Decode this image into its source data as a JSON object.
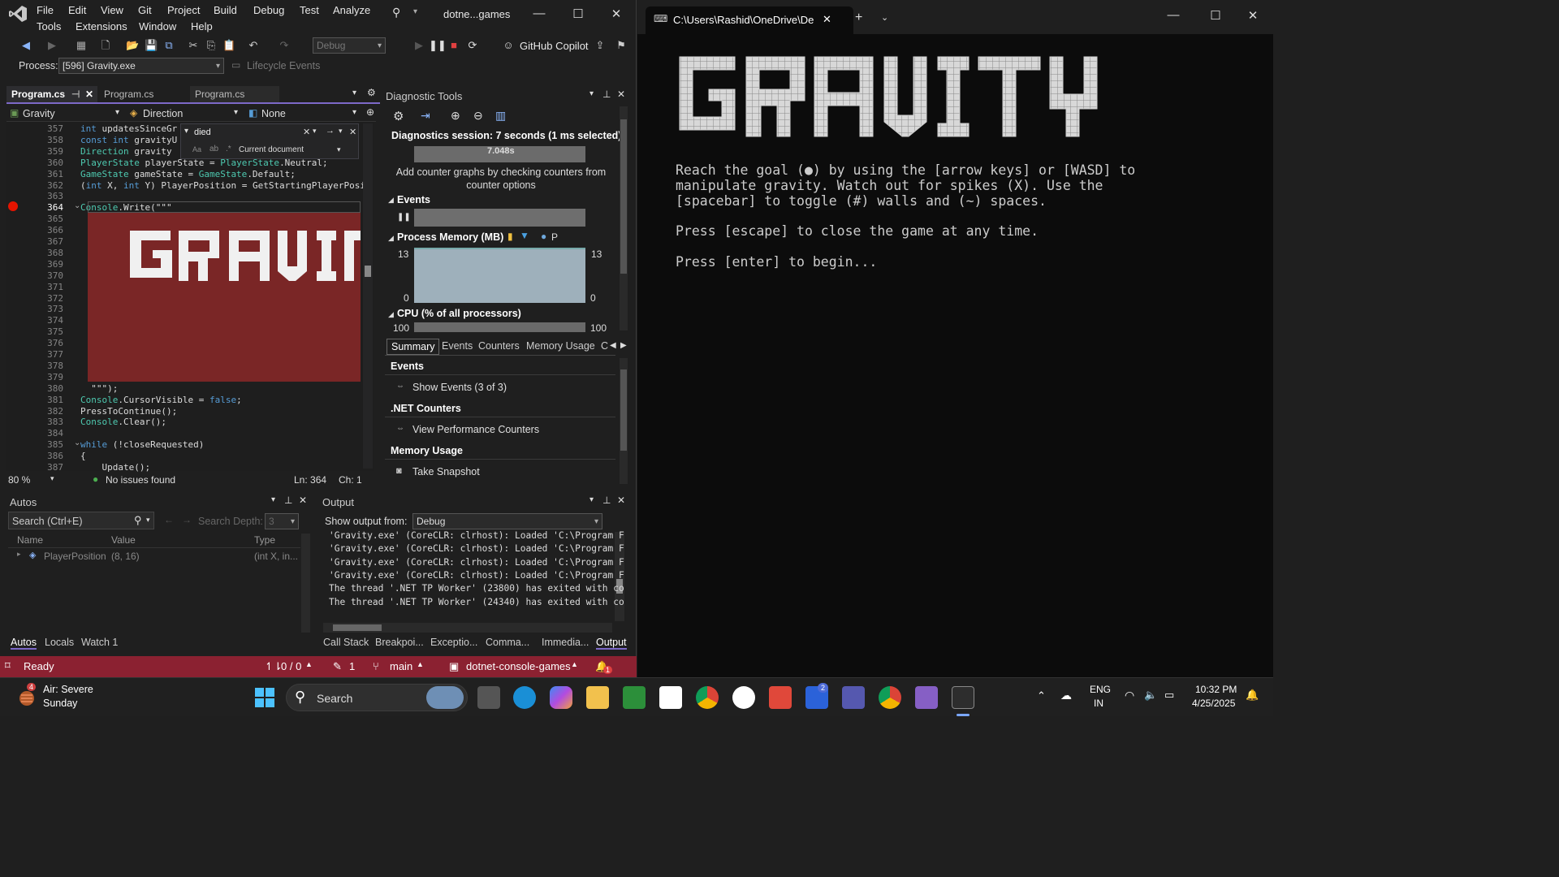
{
  "vs": {
    "menu": [
      "File",
      "Edit",
      "View",
      "Git",
      "Project",
      "Build",
      "Debug",
      "Test",
      "Analyze",
      "Tools",
      "Extensions",
      "Window",
      "Help"
    ],
    "search_title": "dotne...games",
    "toolbar": {
      "config": "Debug",
      "copilot": "GitHub Copilot"
    },
    "process_label": "Process:",
    "process_value": "[596] Gravity.exe",
    "lifecycle": "Lifecycle Events",
    "tabs": [
      "Program.cs",
      "Program.cs",
      "Program.cs"
    ],
    "nav": {
      "project": "Gravity",
      "member": "Direction",
      "scope": "None"
    },
    "find": {
      "text": "died",
      "scope": "Current document"
    },
    "lines": [
      "357",
      "358",
      "359",
      "360",
      "361",
      "362",
      "363",
      "364",
      "365",
      "366",
      "367",
      "368",
      "369",
      "370",
      "371",
      "372",
      "373",
      "374",
      "375",
      "376",
      "377",
      "378",
      "379",
      "380",
      "381",
      "382",
      "383",
      "384",
      "385",
      "386",
      "387"
    ],
    "code": {
      "l357": "int updatesSinceGr",
      "l358": "const int gravityU",
      "l359": "Direction gravity",
      "l360": "PlayerState playerState = PlayerState.Neutral;",
      "l361": "GameState gameState = GameState.Default;",
      "l362": "(int X, int Y) PlayerPosition = GetStartingPlayerPosit",
      "l364": "Console.Write(\"\"\"",
      "l373": "    Reach the goal (●) by using the [arrow keys] o",
      "l374": "    manipulate gravity. Watch out for spikes (X). ",
      "l375": "    [spacebar] to toggle (#) walls and (~) spaces.",
      "l377": "    Press [escape] to close the game at any time.",
      "l379": "    Press [enter] to begin...",
      "l380": "  \"\"\");",
      "l381": "Console.CursorVisible = false;",
      "l382": "PressToContinue();",
      "l383": "Console.Clear();",
      "l385": "while (!closeRequested)",
      "l386": "{",
      "l387": "    Update();"
    },
    "editor_status": {
      "zoom": "80 %",
      "issues": "No issues found",
      "ln": "Ln: 364",
      "ch": "Ch: 1"
    },
    "diag": {
      "title": "Diagnostic Tools",
      "session": "Diagnostics session: 7 seconds (1 ms selected)",
      "timer": "7.048s",
      "hint": "Add counter graphs by checking counters from counter options",
      "events": "Events",
      "memory": "Process Memory (MB)",
      "mem_legend": "P",
      "mem_max": "13",
      "mem_min": "0",
      "cpu": "CPU (% of all processors)",
      "cpu_max": "100",
      "tabs": [
        "Summary",
        "Events",
        "Counters",
        "Memory Usage",
        "C"
      ],
      "sec_events": "Events",
      "show_events": "Show Events (3 of 3)",
      "sec_counters": ".NET Counters",
      "view_counters": "View Performance Counters",
      "sec_memory": "Memory Usage",
      "snapshot": "Take Snapshot"
    },
    "autos": {
      "title": "Autos",
      "search": "Search (Ctrl+E)",
      "depth_label": "Search Depth:",
      "depth": "3",
      "cols": [
        "Name",
        "Value",
        "Type"
      ],
      "row": {
        "name": "PlayerPosition",
        "value": "(8, 16)",
        "type": "(int X, in..."
      },
      "tabs": [
        "Autos",
        "Locals",
        "Watch 1"
      ]
    },
    "output": {
      "title": "Output",
      "show_from": "Show output from:",
      "source": "Debug",
      "lines": [
        "'Gravity.exe' (CoreCLR: clrhost): Loaded 'C:\\Program F",
        "'Gravity.exe' (CoreCLR: clrhost): Loaded 'C:\\Program F",
        "'Gravity.exe' (CoreCLR: clrhost): Loaded 'C:\\Program F",
        "'Gravity.exe' (CoreCLR: clrhost): Loaded 'C:\\Program F",
        "The thread '.NET TP Worker' (23800) has exited with co",
        "The thread '.NET TP Worker' (24340) has exited with co"
      ],
      "tabs": [
        "Call Stack",
        "Breakpoi...",
        "Exceptio...",
        "Comma...",
        "Immedia...",
        "Output"
      ]
    },
    "status": {
      "ready": "Ready",
      "updown": "0 / 0",
      "edits": "1",
      "branch": "main",
      "repo": "dotnet-console-games",
      "notif": "1"
    }
  },
  "terminal": {
    "tab_title": "C:\\Users\\Rashid\\OneDrive\\De",
    "ascii_title": "GRAVITY",
    "lines": [
      "Reach the goal (●) by using the [arrow keys] or [WASD] to",
      "manipulate gravity. Watch out for spikes (X). Use the",
      "[spacebar] to toggle (#) walls and (~) spaces.",
      "Press [escape] to close the game at any time.",
      "Press [enter] to begin..."
    ]
  },
  "taskbar": {
    "weather_temp": "4",
    "weather_title": "Air: Severe",
    "weather_day": "Sunday",
    "search": "Search",
    "lang1": "ENG",
    "lang2": "IN",
    "time": "10:32 PM",
    "date": "4/25/2025",
    "badge_l": "2"
  },
  "colors": {
    "status": "#8b2131",
    "accent": "#7d69c8",
    "highlight": "#7a2626"
  }
}
